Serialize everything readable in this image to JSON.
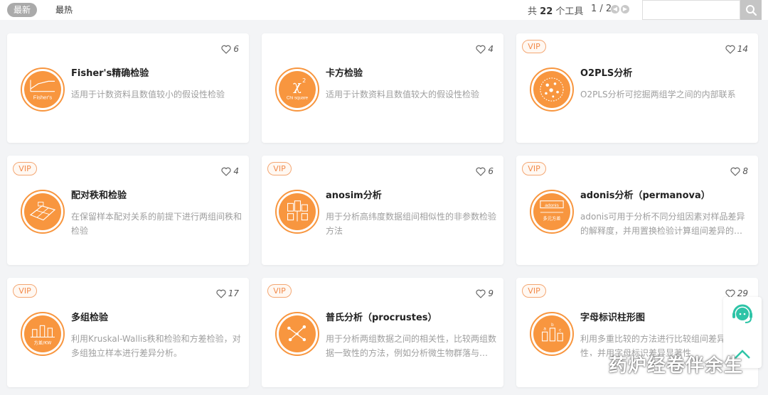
{
  "toolbar": {
    "sort_latest": "最新",
    "sort_hot": "最热",
    "total_prefix": "共",
    "total_count": "22",
    "total_suffix": "个工具",
    "page_info": "1 / 2",
    "search_placeholder": ""
  },
  "cards": [
    {
      "title": "Fisher's精确检验",
      "desc": "适用于计数资料且数值较小的假设性检验",
      "likes": "6",
      "vip": "",
      "icon": "fisher-icon",
      "icon_text": "Fisher's"
    },
    {
      "title": "卡方检验",
      "desc": "适用于计数资料且数值较大的假设性检验",
      "likes": "4",
      "vip": "",
      "icon": "chi-square-icon",
      "icon_text": "Chi square"
    },
    {
      "title": "O2PLS分析",
      "desc": "O2PLS分析可挖掘两组学之间的内部联系",
      "likes": "14",
      "vip": "VIP",
      "icon": "o2pls-icon",
      "icon_text": ""
    },
    {
      "title": "配对秩和检验",
      "desc": "在保留样本配对关系的前提下进行两组间秩和检验",
      "likes": "4",
      "vip": "VIP",
      "icon": "paired-rank-icon",
      "icon_text": ""
    },
    {
      "title": "anosim分析",
      "desc": "用于分析高纬度数据组间相似性的非参数检验方法",
      "likes": "6",
      "vip": "VIP",
      "icon": "anosim-icon",
      "icon_text": ""
    },
    {
      "title": "adonis分析（permanova）",
      "desc": "adonis可用于分析不同分组因素对样品差异的解释度，并用置换检验计算组间差异的显著性",
      "likes": "8",
      "vip": "VIP",
      "icon": "adonis-icon",
      "icon_text": "adonis",
      "icon_text2": "多元方差"
    },
    {
      "title": "多组检验",
      "desc": "利用Kruskal-Wallis秩和检验和方差检验，对多组独立样本进行差异分析。",
      "likes": "17",
      "vip": "VIP",
      "icon": "multi-group-icon",
      "icon_text": "方差/KW"
    },
    {
      "title": "普氏分析（procrustes）",
      "desc": "用于分析两组数据之间的相关性，比较两组数据一致性的方法，例如分析微生物群落与环境因子",
      "likes": "9",
      "vip": "VIP",
      "icon": "procrustes-icon",
      "icon_text": ""
    },
    {
      "title": "字母标识柱形图",
      "desc": "利用多重比较的方法进行比较组间差异显著性，并用字母标识差异显著性",
      "likes": "29",
      "vip": "VIP",
      "icon": "letter-bar-icon",
      "icon_text": ""
    }
  ],
  "watermark": "药炉经卷伴余生",
  "colors": {
    "accent": "#f8963f",
    "vip": "#f28b4c",
    "muted": "#9e9e9e"
  }
}
